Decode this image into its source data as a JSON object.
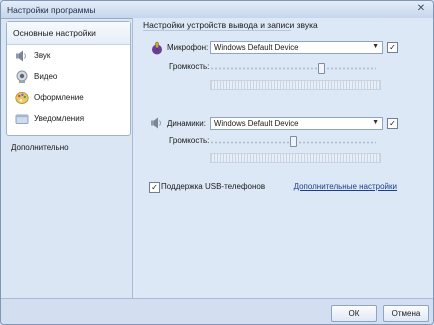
{
  "window": {
    "title": "Настройки программы"
  },
  "sidebar": {
    "header": "Основные настройки",
    "items": [
      {
        "label": "Звук",
        "icon": "speaker-icon"
      },
      {
        "label": "Видео",
        "icon": "webcam-icon"
      },
      {
        "label": "Оформление",
        "icon": "palette-icon"
      },
      {
        "label": "Уведомления",
        "icon": "notifications-icon"
      }
    ],
    "extra": "Дополнительно"
  },
  "main": {
    "section_title": "Настройки устройств вывода и записи звука",
    "microphone": {
      "label": "Микрофон:",
      "device": "Windows Default Device",
      "enabled": true,
      "volume_label": "Громкость:",
      "volume": 0.67
    },
    "speakers": {
      "label": "Динамики:",
      "device": "Windows Default Device",
      "enabled": true,
      "volume_label": "Громкость:",
      "volume": 0.5
    },
    "usb_phones": {
      "label": "Поддержка USB-телефонов",
      "checked": true
    },
    "advanced_link": "Дополнительные настройки"
  },
  "footer": {
    "ok": "ОК",
    "cancel": "Отмена"
  },
  "colors": {
    "accent": "#1d3f8a",
    "window_bg": "#dde8f6"
  }
}
